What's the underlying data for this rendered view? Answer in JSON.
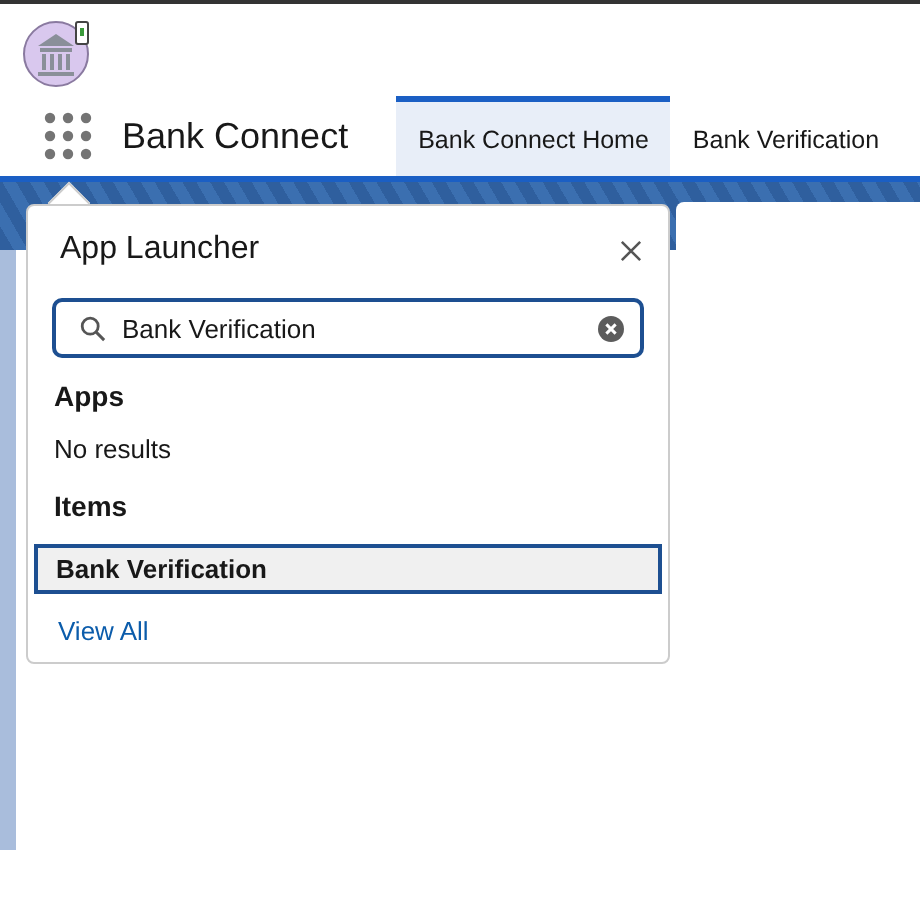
{
  "app_name": "Bank Connect",
  "tabs": [
    {
      "label": "Bank Connect Home",
      "selected": true
    },
    {
      "label": "Bank Verification",
      "selected": false
    }
  ],
  "launcher": {
    "title": "App Launcher",
    "search": {
      "value": "Bank Verification"
    },
    "sections": [
      {
        "title": "Apps",
        "empty_text": "No results"
      },
      {
        "title": "Items",
        "items": [
          {
            "label": "Bank Verification",
            "selected": true
          }
        ]
      }
    ],
    "view_all": "View All"
  }
}
